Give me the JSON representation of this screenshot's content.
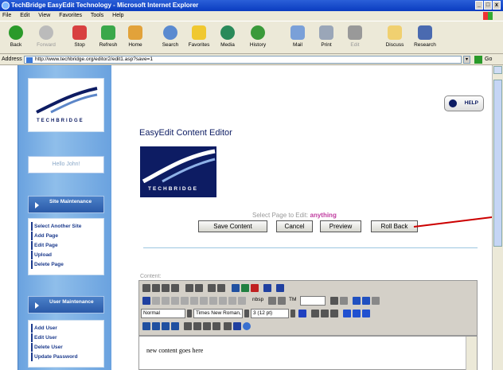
{
  "window": {
    "title": "TechBridge EasyEdit Technology - Microsoft Internet Explorer",
    "controls": [
      "_",
      "□",
      "x"
    ]
  },
  "menubar": [
    "File",
    "Edit",
    "View",
    "Favorites",
    "Tools",
    "Help"
  ],
  "toolbar": {
    "back": "Back",
    "forward": "Forward",
    "stop": "Stop",
    "refresh": "Refresh",
    "home": "Home",
    "search": "Search",
    "favorites": "Favorites",
    "media": "Media",
    "history": "History",
    "mail": "Mail",
    "print": "Print",
    "edit": "Edit",
    "discuss": "Discuss",
    "research": "Research"
  },
  "addressbar": {
    "label": "Address",
    "url": "http://www.techbridge.org/editor2/edit1.asp?save=1",
    "go": "Go"
  },
  "sidebar": {
    "greeting": "Hello John!",
    "site_maintenance": {
      "title": "Site Maintenance",
      "items": [
        "Select Another Site",
        "Add Page",
        "Edit Page",
        "Upload",
        "Delete Page"
      ]
    },
    "user_maintenance": {
      "title": "User Maintenance",
      "items": [
        "Add User",
        "Edit User",
        "Delete User",
        "Update Password"
      ]
    }
  },
  "logo": {
    "text": "TECHBRIDGE"
  },
  "main": {
    "help": "HELP",
    "title": "EasyEdit Content Editor",
    "select_label": "Select Page to Edit:",
    "select_value": "anything",
    "buttons": {
      "save": "Save Content",
      "cancel": "Cancel",
      "preview": "Preview",
      "rollback": "Roll Back"
    },
    "content_label": "Content:",
    "editor": {
      "style": "Normal",
      "font": "Times New Roman,",
      "size": "3 (12 pt)",
      "nbsp": "nbsp",
      "tm": "TM",
      "body_text": "new content goes here"
    }
  },
  "colors": {
    "accent": "#0d1c63",
    "sidebar": "#6aa2df",
    "highlight": "#c03ca0",
    "callout": "#cc0000"
  }
}
